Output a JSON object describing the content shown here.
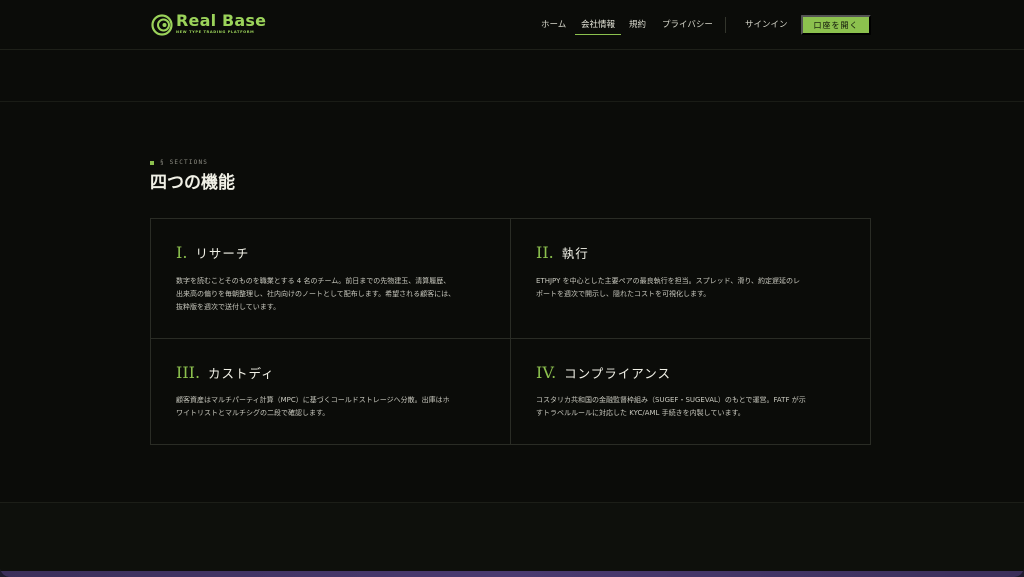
{
  "brand": {
    "name": "Real Base",
    "tagline": "NEW TYPE TRADING PLATFORM",
    "accent": "#8cc14e"
  },
  "nav": {
    "items": [
      {
        "label": "ホーム",
        "active": false
      },
      {
        "label": "会社情報",
        "active": true
      },
      {
        "label": "規約",
        "active": false
      },
      {
        "label": "プライバシー",
        "active": false
      }
    ],
    "signin": "サインイン",
    "cta": "口座を開く"
  },
  "section": {
    "eyebrow": "§ SECTIONS",
    "title": "四つの機能",
    "cards": [
      {
        "numeral": "I.",
        "name": "リサーチ",
        "lines": [
          "数字を読むことそのものを職業とする 4 名のチーム。前日までの先物建玉、清算履歴、",
          "出来高の偏りを毎朝整理し、社内向けのノートとして配布します。希望される顧客には、",
          "抜粋版を週次で送付しています。"
        ]
      },
      {
        "numeral": "II.",
        "name": "執行",
        "lines": [
          "ETHJPY を中心とした主要ペアの最良執行を担当。スプレッド、滑り、約定遅延のレ",
          "ポートを週次で開示し、隠れたコストを可視化します。"
        ]
      },
      {
        "numeral": "III.",
        "name": "カストディ",
        "lines": [
          "顧客資産はマルチパーティ計算（MPC）に基づくコールドストレージへ分散。出庫はホ",
          "ワイトリストとマルチシグの二段で確認します。"
        ]
      },
      {
        "numeral": "IV.",
        "name": "コンプライアンス",
        "lines": [
          "コスタリカ共和国の金融監督枠組み（SUGEF・SUGEVAL）のもとで運営。FATF が示",
          "すトラベルルールに対応した KYC/AML 手続きを内製しています。"
        ]
      }
    ]
  }
}
